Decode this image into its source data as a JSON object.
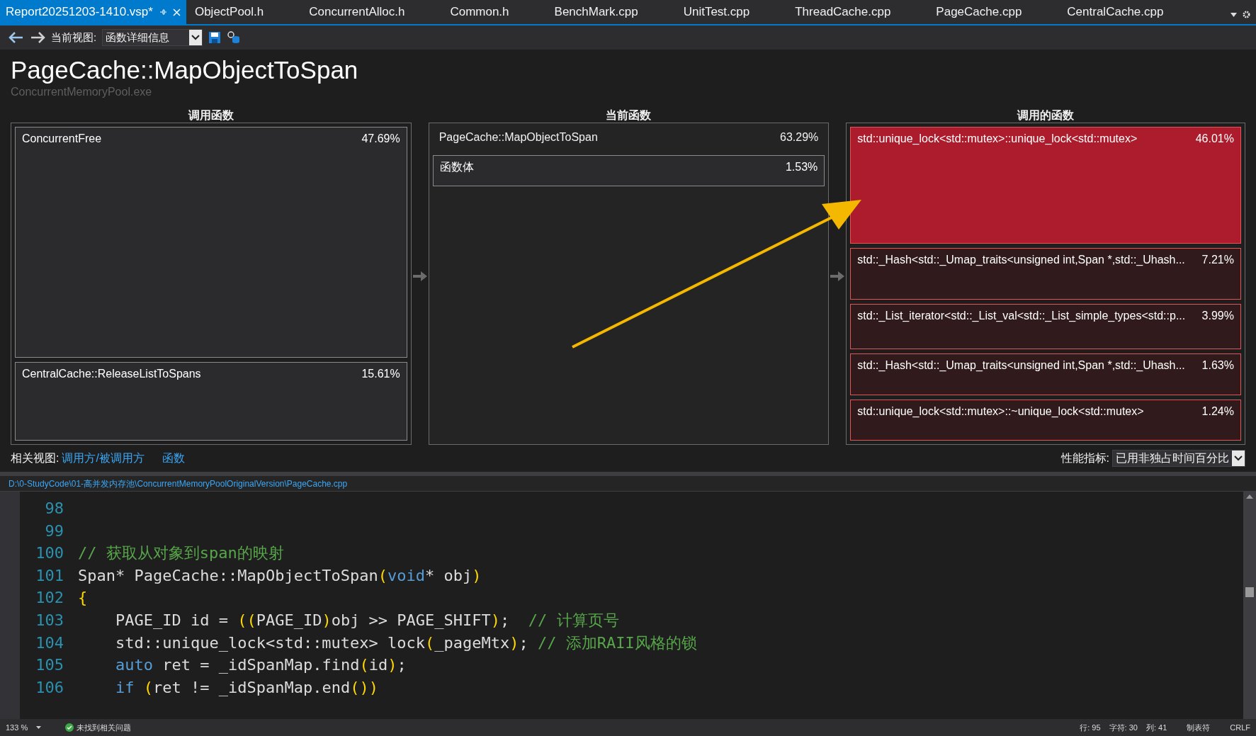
{
  "tabs": [
    {
      "label": "Report20251203-1410.vsp*",
      "selected": true
    },
    {
      "label": "ObjectPool.h",
      "selected": false
    },
    {
      "label": "ConcurrentAlloc.h",
      "selected": false
    },
    {
      "label": "Common.h",
      "selected": false
    },
    {
      "label": "BenchMark.cpp",
      "selected": false
    },
    {
      "label": "UnitTest.cpp",
      "selected": false
    },
    {
      "label": "ThreadCache.cpp",
      "selected": false
    },
    {
      "label": "PageCache.cpp",
      "selected": false
    },
    {
      "label": "CentralCache.cpp",
      "selected": false
    }
  ],
  "toolbar": {
    "view_label": "当前视图:",
    "view_value": "函数详细信息"
  },
  "title": "PageCache::MapObjectToSpan",
  "subtitle": "ConcurrentMemoryPool.exe",
  "callers": {
    "heading": "调用函数",
    "items": [
      {
        "name": "ConcurrentFree",
        "percent": "47.69%"
      },
      {
        "name": "CentralCache::ReleaseListToSpans",
        "percent": "15.61%"
      }
    ]
  },
  "current": {
    "heading": "当前函数",
    "name": "PageCache::MapObjectToSpan",
    "percent": "63.29%",
    "body": {
      "name": "函数体",
      "percent": "1.53%"
    }
  },
  "callees": {
    "heading": "调用的函数",
    "items": [
      {
        "name": "std::unique_lock<std::mutex>::unique_lock<std::mutex>",
        "percent": "46.01%",
        "color": "#ac1c2c"
      },
      {
        "name": "std::_Hash<std::_Umap_traits<unsigned int,Span *,std::_Uhash...",
        "percent": "7.21%",
        "color": "#311a1c"
      },
      {
        "name": "std::_List_iterator<std::_List_val<std::_List_simple_types<std::p...",
        "percent": "3.99%",
        "color": "#311a1c"
      },
      {
        "name": "std::_Hash<std::_Umap_traits<unsigned int,Span *,std::_Uhash...",
        "percent": "1.63%",
        "color": "#311a1c"
      },
      {
        "name": "std::unique_lock<std::mutex>::~unique_lock<std::mutex>",
        "percent": "1.24%",
        "color": "#311a1c"
      }
    ]
  },
  "related": {
    "label": "相关视图:",
    "links": [
      "调用方/被调用方",
      "函数"
    ]
  },
  "metric": {
    "label": "性能指标:",
    "value": "已用非独占时间百分比"
  },
  "file_path": "D:\\0-StudyCode\\01-高并发内存池\\ConcurrentMemoryPoolOriginalVersion\\PageCache.cpp",
  "code": [
    {
      "number": "98"
    },
    {
      "number": "99"
    },
    {
      "number": "100",
      "tokens": [
        {
          "text": "// 获取从对象到span的映射",
          "kind": "comment"
        }
      ]
    },
    {
      "number": "101",
      "tokens": [
        {
          "text": "Span* PageCache::MapObjectToSpan",
          "kind": "plain"
        },
        {
          "text": "(",
          "kind": "paren"
        },
        {
          "text": "void",
          "kind": "keyword"
        },
        {
          "text": "* obj",
          "kind": "plain"
        },
        {
          "text": ")",
          "kind": "paren"
        }
      ]
    },
    {
      "number": "102",
      "tokens": [
        {
          "text": "{",
          "kind": "paren"
        }
      ]
    },
    {
      "number": "103",
      "tokens": [
        {
          "text": "    PAGE_ID id = ",
          "kind": "plain"
        },
        {
          "text": "((",
          "kind": "paren"
        },
        {
          "text": "PAGE_ID",
          "kind": "plain"
        },
        {
          "text": ")",
          "kind": "paren"
        },
        {
          "text": "obj >> PAGE_SHIFT",
          "kind": "plain"
        },
        {
          "text": ")",
          "kind": "paren"
        },
        {
          "text": ";  ",
          "kind": "plain"
        },
        {
          "text": "// 计算页号",
          "kind": "comment"
        }
      ]
    },
    {
      "number": "104",
      "tokens": [
        {
          "text": "    std::unique_lock<std::mutex> lock",
          "kind": "plain"
        },
        {
          "text": "(",
          "kind": "paren"
        },
        {
          "text": "_pageMtx",
          "kind": "plain"
        },
        {
          "text": ")",
          "kind": "paren"
        },
        {
          "text": "; ",
          "kind": "plain"
        },
        {
          "text": "// 添加RAII风格的锁",
          "kind": "comment"
        }
      ]
    },
    {
      "number": "105",
      "indented": true,
      "tokens": [
        {
          "text": "auto",
          "kind": "keyword"
        },
        {
          "text": " ret = _idSpanMap.find",
          "kind": "plain"
        },
        {
          "text": "(",
          "kind": "paren"
        },
        {
          "text": "id",
          "kind": "plain"
        },
        {
          "text": ")",
          "kind": "paren"
        },
        {
          "text": ";",
          "kind": "plain"
        }
      ]
    },
    {
      "number": "106",
      "indented": true,
      "tokens": [
        {
          "text": "if",
          "kind": "keyword"
        },
        {
          "text": " (",
          "kind": "paren"
        },
        {
          "text": "ret != _idSpanMap.end",
          "kind": "plain"
        },
        {
          "text": "())",
          "kind": "paren"
        }
      ]
    }
  ],
  "status_bar": {
    "zoom": "133 %",
    "issues": "未找到相关问题",
    "line": "行: 95",
    "char": "字符: 30",
    "col": "列: 41",
    "tabs": "制表符",
    "eol": "CRLF"
  }
}
